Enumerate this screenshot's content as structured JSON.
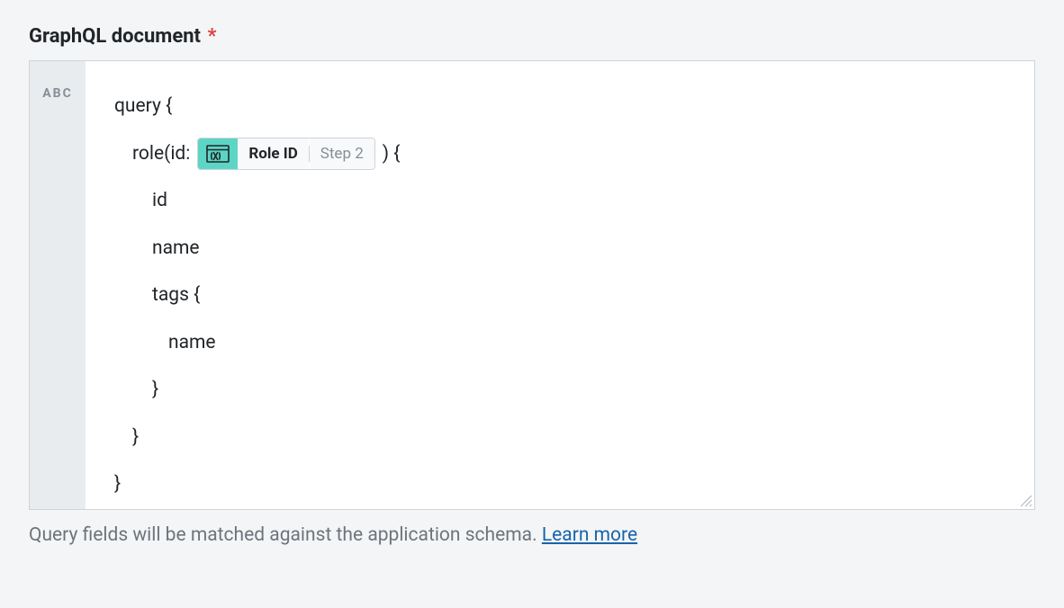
{
  "field": {
    "label": "GraphQL document",
    "required_mark": "*"
  },
  "gutter": {
    "label": "ABC"
  },
  "code": {
    "line1": "query {",
    "line2_prefix": "role(id:",
    "line2_suffix": ") {",
    "line3": "id",
    "line4": "name",
    "line5": "tags {",
    "line6": "name",
    "line7": "}",
    "line8": "}",
    "line9": "}"
  },
  "variable": {
    "label": "Role ID",
    "step": "Step 2"
  },
  "helper": {
    "text": "Query fields will be matched against the application schema. ",
    "link": "Learn more"
  }
}
